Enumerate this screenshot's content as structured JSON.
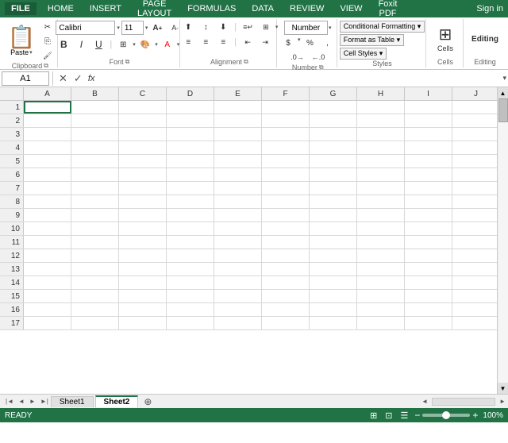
{
  "titlebar": {
    "file_label": "FILE",
    "tabs": [
      "HOME",
      "INSERT",
      "PAGE LAYOUT",
      "FORMULAS",
      "DATA",
      "REVIEW",
      "VIEW"
    ],
    "extra_tabs": [
      "Foxit PDF"
    ],
    "sign_in": "Sign in"
  },
  "ribbon": {
    "active_tab": "HOME",
    "groups": {
      "clipboard": {
        "label": "Clipboard",
        "paste_label": "Paste"
      },
      "font": {
        "label": "Font",
        "font_name": "Calibri",
        "font_size": "11",
        "bold": "B",
        "italic": "I",
        "underline": "U",
        "increase_font": "A",
        "decrease_font": "A",
        "borders": "⊞",
        "fill_color": "A",
        "font_color": "A"
      },
      "alignment": {
        "label": "Alignment"
      },
      "number": {
        "label": "Number",
        "format": "Number"
      },
      "styles": {
        "label": "Styles",
        "conditional": "Conditional Formatting ▾",
        "format_table": "Format as Table ▾",
        "cell_styles": "Cell Styles ▾"
      },
      "cells": {
        "label": "Cells",
        "cells_label": "Cells"
      },
      "editing": {
        "label": "Editing",
        "editing_label": "Editing"
      }
    }
  },
  "formula_bar": {
    "cell_ref": "A1",
    "cancel_icon": "✕",
    "confirm_icon": "✓",
    "fx_label": "fx"
  },
  "spreadsheet": {
    "columns": [
      "A",
      "B",
      "C",
      "D",
      "E",
      "F",
      "G",
      "H",
      "I",
      "J"
    ],
    "rows": [
      "1",
      "2",
      "3",
      "4",
      "5",
      "6",
      "7",
      "8",
      "9",
      "10",
      "11",
      "12",
      "13",
      "14",
      "15",
      "16",
      "17"
    ]
  },
  "sheet_tabs": {
    "tabs": [
      "Sheet1",
      "Sheet2"
    ],
    "active": "Sheet2"
  },
  "status_bar": {
    "ready": "READY",
    "zoom": "100%"
  }
}
